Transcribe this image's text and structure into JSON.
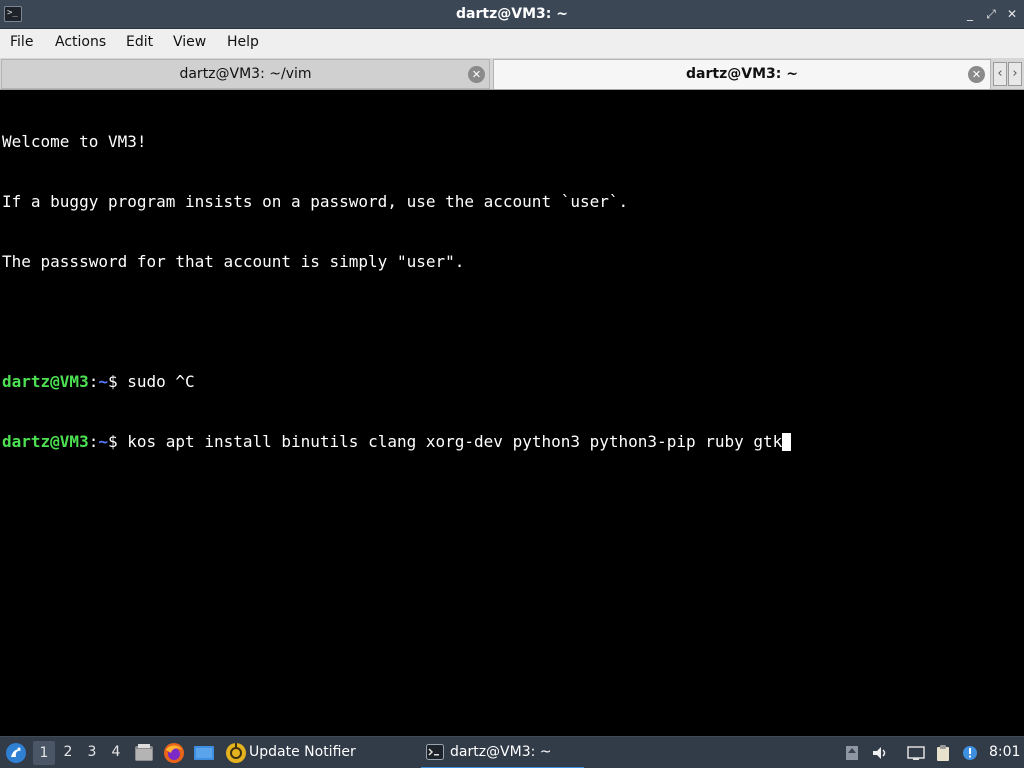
{
  "window": {
    "title": "dartz@VM3: ~",
    "controls": {
      "minimize": "_",
      "restore": "⤢",
      "close": "✕"
    }
  },
  "menu": [
    "File",
    "Actions",
    "Edit",
    "View",
    "Help"
  ],
  "tabs": [
    {
      "label": "dartz@VM3: ~/vim",
      "active": false
    },
    {
      "label": "dartz@VM3: ~",
      "active": true
    }
  ],
  "tab_scroll": {
    "left": "‹",
    "right": "›"
  },
  "terminal": {
    "welcome_lines": [
      "Welcome to VM3!",
      "If a buggy program insists on a password, use the account `user`.",
      "The passsword for that account is simply \"user\"."
    ],
    "prompt_user": "dartz@VM3",
    "prompt_sep": ":",
    "prompt_path": "~",
    "prompt_symbol": "$ ",
    "commands": [
      "sudo ^C",
      "kos apt install binutils clang xorg-dev python3 python3-pip ruby gtk"
    ],
    "colors": {
      "user": "#4ce052",
      "path": "#5b7bff",
      "background": "#000000"
    }
  },
  "taskbar": {
    "desktops": [
      "1",
      "2",
      "3",
      "4"
    ],
    "active_desktop": "1",
    "launchers": [
      "start-menu-icon",
      "file-manager-icon",
      "firefox-icon",
      "desktop-icon"
    ],
    "tasks": [
      {
        "label": "Update Notifier",
        "icon": "update-notifier-icon"
      },
      {
        "label": "dartz@VM3: ~",
        "icon": "terminal-icon",
        "active": true
      }
    ],
    "tray": [
      "upload-icon",
      "volume-icon",
      "network-icon",
      "clipboard-icon",
      "notification-icon"
    ],
    "clock": "8:01"
  }
}
